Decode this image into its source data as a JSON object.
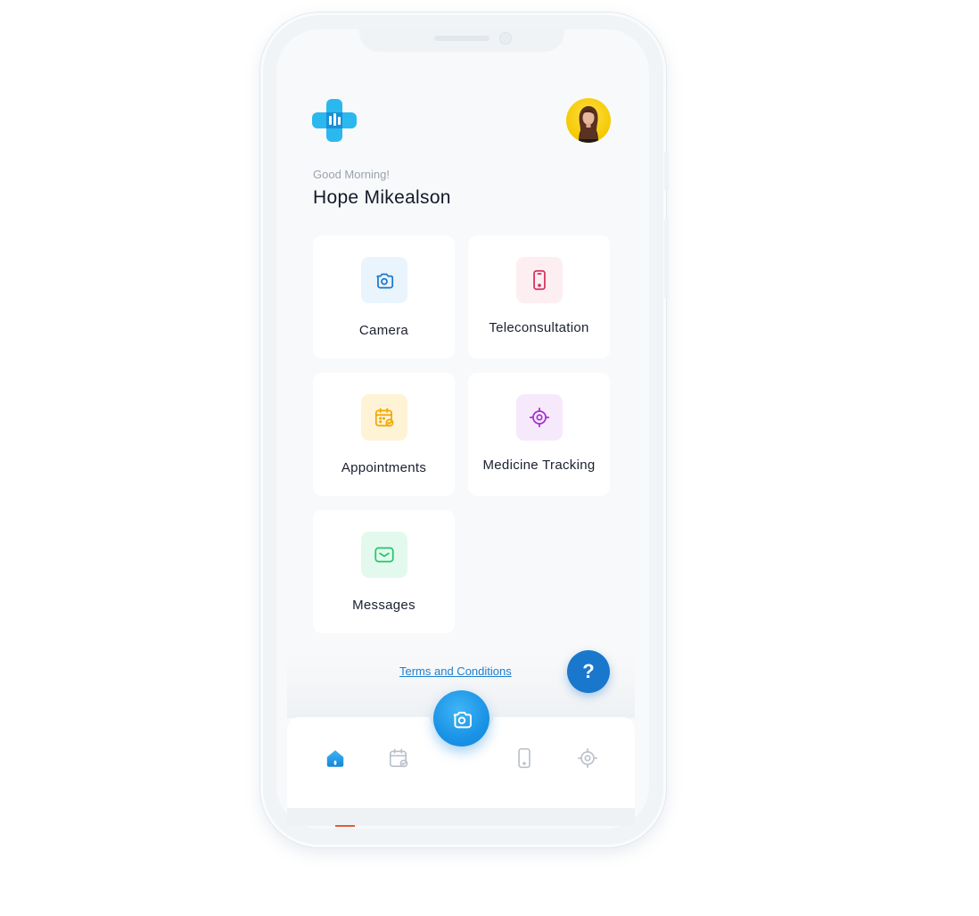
{
  "header": {
    "greeting": "Good Morning!",
    "user_name": "Hope Mikealson"
  },
  "features": [
    {
      "label": "Camera",
      "icon": "camera-icon",
      "color": "#1a78cc",
      "bg": "#eaf4fd"
    },
    {
      "label": "Teleconsultation",
      "icon": "mobile-phone-icon",
      "color": "#d62f5b",
      "bg": "#fdeef2"
    },
    {
      "label": "Appointments",
      "icon": "calendar-icon",
      "color": "#f0a700",
      "bg": "#fff3d6"
    },
    {
      "label": "Medicine Tracking",
      "icon": "target-icon",
      "color": "#a32fd1",
      "bg": "#f7e9fc"
    },
    {
      "label": "Messages",
      "icon": "message-icon",
      "color": "#22c76a",
      "bg": "#e4f9ee"
    }
  ],
  "footer": {
    "terms_label": "Terms and Conditions",
    "help_label": "?"
  },
  "bottom_nav": {
    "items": [
      {
        "icon": "home-icon",
        "active": true
      },
      {
        "icon": "calendar-icon",
        "active": false
      },
      {
        "icon": "camera-icon",
        "active": false
      },
      {
        "icon": "mobile-phone-icon",
        "active": false
      },
      {
        "icon": "target-icon",
        "active": false
      }
    ],
    "active_color": "#1a93e6",
    "inactive_color": "#b9c0c9"
  }
}
